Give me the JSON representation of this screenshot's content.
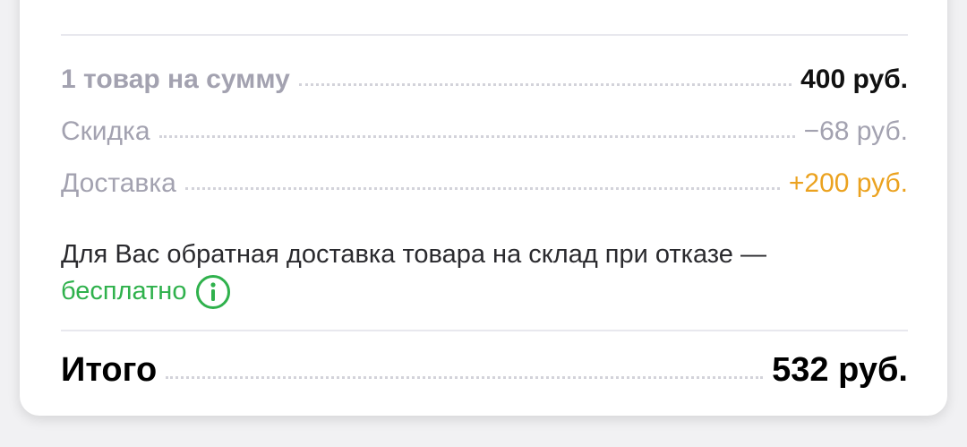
{
  "summary": {
    "items_label": "1 товар на сумму",
    "items_value": "400 руб.",
    "discount_label": "Скидка",
    "discount_value": "−68 руб.",
    "delivery_label": "Доставка",
    "delivery_value": "+200 руб."
  },
  "return_note": {
    "text": "Для Вас обратная доставка товара на склад при отказе —",
    "free_text": "бесплатно",
    "icon": "info-icon"
  },
  "total": {
    "label": "Итого",
    "value": "532 руб."
  },
  "colors": {
    "accent_green": "#2fb14c",
    "delivery_orange": "#eba21f",
    "muted_text": "#a3a2b0"
  }
}
